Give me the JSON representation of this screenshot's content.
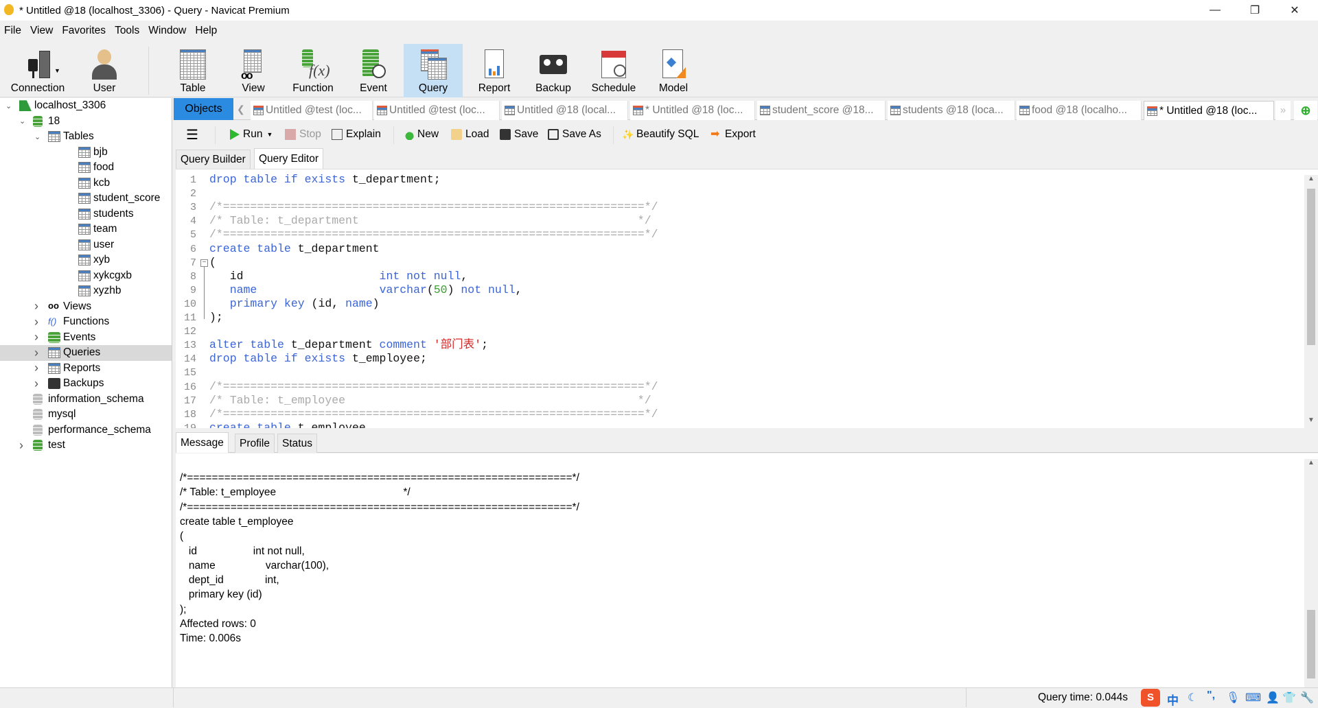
{
  "window": {
    "title": "* Untitled @18 (localhost_3306) - Query - Navicat Premium",
    "minimize": "—",
    "restore": "❐",
    "close": "✕"
  },
  "menu": [
    "File",
    "View",
    "Favorites",
    "Tools",
    "Window",
    "Help"
  ],
  "toolbar": {
    "connection": "Connection",
    "user": "User",
    "table": "Table",
    "view": "View",
    "function": "Function",
    "event": "Event",
    "query": "Query",
    "report": "Report",
    "backup": "Backup",
    "schedule": "Schedule",
    "model": "Model",
    "active": "Query",
    "active_color": "#c5dff5"
  },
  "tree": [
    {
      "label": "localhost_3306",
      "level": 0,
      "expanded": true,
      "icon": "connection-icon"
    },
    {
      "label": "18",
      "level": 1,
      "expanded": true,
      "icon": "database-icon"
    },
    {
      "label": "Tables",
      "level": 2,
      "expanded": true,
      "icon": "tables-icon"
    },
    {
      "label": "bjb",
      "level": 3,
      "icon": "table-icon"
    },
    {
      "label": "food",
      "level": 3,
      "icon": "table-icon"
    },
    {
      "label": "kcb",
      "level": 3,
      "icon": "table-icon"
    },
    {
      "label": "student_score",
      "level": 3,
      "icon": "table-icon"
    },
    {
      "label": "students",
      "level": 3,
      "icon": "table-icon"
    },
    {
      "label": "team",
      "level": 3,
      "icon": "table-icon"
    },
    {
      "label": "user",
      "level": 3,
      "icon": "table-icon"
    },
    {
      "label": "xyb",
      "level": 3,
      "icon": "table-icon"
    },
    {
      "label": "xykcgxb",
      "level": 3,
      "icon": "table-icon"
    },
    {
      "label": "xyzhb",
      "level": 3,
      "icon": "table-icon"
    },
    {
      "label": "Views",
      "level": 2,
      "expanded": false,
      "icon": "views-icon"
    },
    {
      "label": "Functions",
      "level": 2,
      "expanded": false,
      "icon": "functions-icon"
    },
    {
      "label": "Events",
      "level": 2,
      "expanded": false,
      "icon": "events-icon"
    },
    {
      "label": "Queries",
      "level": 2,
      "expanded": false,
      "icon": "queries-icon",
      "selected": true
    },
    {
      "label": "Reports",
      "level": 2,
      "expanded": false,
      "icon": "reports-icon"
    },
    {
      "label": "Backups",
      "level": 2,
      "expanded": false,
      "icon": "backups-icon"
    },
    {
      "label": "information_schema",
      "level": 1,
      "icon": "database-closed-icon"
    },
    {
      "label": "mysql",
      "level": 1,
      "icon": "database-closed-icon"
    },
    {
      "label": "performance_schema",
      "level": 1,
      "icon": "database-closed-icon"
    },
    {
      "label": "test",
      "level": 1,
      "expanded": false,
      "icon": "database-icon"
    }
  ],
  "tabs": {
    "objects": "Objects",
    "items": [
      {
        "label": "Untitled @test (loc...",
        "icon": "query-icon"
      },
      {
        "label": "Untitled @test (loc...",
        "icon": "query-icon"
      },
      {
        "label": "Untitled @18 (local...",
        "icon": "design-icon"
      },
      {
        "label": "* Untitled @18 (loc...",
        "icon": "query-icon"
      },
      {
        "label": "student_score @18...",
        "icon": "table-icon"
      },
      {
        "label": "students @18 (loca...",
        "icon": "table-icon"
      },
      {
        "label": "food @18 (localho...",
        "icon": "table-icon"
      },
      {
        "label": "* Untitled @18 (loc...",
        "icon": "query-icon",
        "active": true
      }
    ]
  },
  "editor_toolbar": {
    "run": "Run",
    "stop": "Stop",
    "explain": "Explain",
    "new": "New",
    "load": "Load",
    "save": "Save",
    "save_as": "Save As",
    "beautify": "Beautify SQL",
    "export": "Export"
  },
  "query_tabs": [
    "Query Builder",
    "Query Editor"
  ],
  "active_query_tab": "Query Editor",
  "code": [
    [
      [
        "drop table if exists",
        "k"
      ],
      [
        " t_department;",
        "p"
      ]
    ],
    [],
    [
      [
        "/*==============================================================*/",
        "c"
      ]
    ],
    [
      [
        "/* Table: t_department                                         */",
        "c"
      ]
    ],
    [
      [
        "/*==============================================================*/",
        "c"
      ]
    ],
    [
      [
        "create table",
        "k"
      ],
      [
        " t_department",
        "p"
      ]
    ],
    [
      [
        "(",
        "p"
      ]
    ],
    [
      [
        "   id                    ",
        "p"
      ],
      [
        "int not null",
        "k"
      ],
      [
        ",",
        "p"
      ]
    ],
    [
      [
        "   ",
        "p"
      ],
      [
        "name",
        "k"
      ],
      [
        "                  ",
        "p"
      ],
      [
        "varchar",
        "k"
      ],
      [
        "(",
        "p"
      ],
      [
        "50",
        "n"
      ],
      [
        ") ",
        "p"
      ],
      [
        "not null",
        "k"
      ],
      [
        ",",
        "p"
      ]
    ],
    [
      [
        "   ",
        "p"
      ],
      [
        "primary key",
        "k"
      ],
      [
        " (id, ",
        "p"
      ],
      [
        "name",
        "k"
      ],
      [
        ")",
        "p"
      ]
    ],
    [
      [
        ");",
        "p"
      ]
    ],
    [],
    [
      [
        "alter table",
        "k"
      ],
      [
        " t_department ",
        "p"
      ],
      [
        "comment",
        "k"
      ],
      [
        " ",
        "p"
      ],
      [
        "'部门表'",
        "s"
      ],
      [
        ";",
        "p"
      ]
    ],
    [
      [
        "drop table if exists",
        "k"
      ],
      [
        " t_employee;",
        "p"
      ]
    ],
    [],
    [
      [
        "/*==============================================================*/",
        "c"
      ]
    ],
    [
      [
        "/* Table: t_employee                                           */",
        "c"
      ]
    ],
    [
      [
        "/*==============================================================*/",
        "c"
      ]
    ],
    [
      [
        "create table",
        "k"
      ],
      [
        " t_employee",
        "p"
      ]
    ]
  ],
  "message_tabs": [
    "Message",
    "Profile",
    "Status"
  ],
  "active_message_tab": "Message",
  "message_lines": [
    "/*==============================================================*/",
    "/* Table: t_employee                                           */",
    "/*==============================================================*/",
    "create table t_employee",
    "(",
    "   id                   int not null,",
    "   name                 varchar(100),",
    "   dept_id              int,",
    "   primary key (id)",
    ");",
    "Affected rows: 0",
    "Time: 0.006s"
  ],
  "status": {
    "query_time": "Query time: 0.044s",
    "ime": "中"
  },
  "colors": {
    "accent": "#2b8be0",
    "keyword": "#3a64d8",
    "comment": "#aaaaaa",
    "string": "#d42a2a",
    "number": "#3aa030"
  }
}
